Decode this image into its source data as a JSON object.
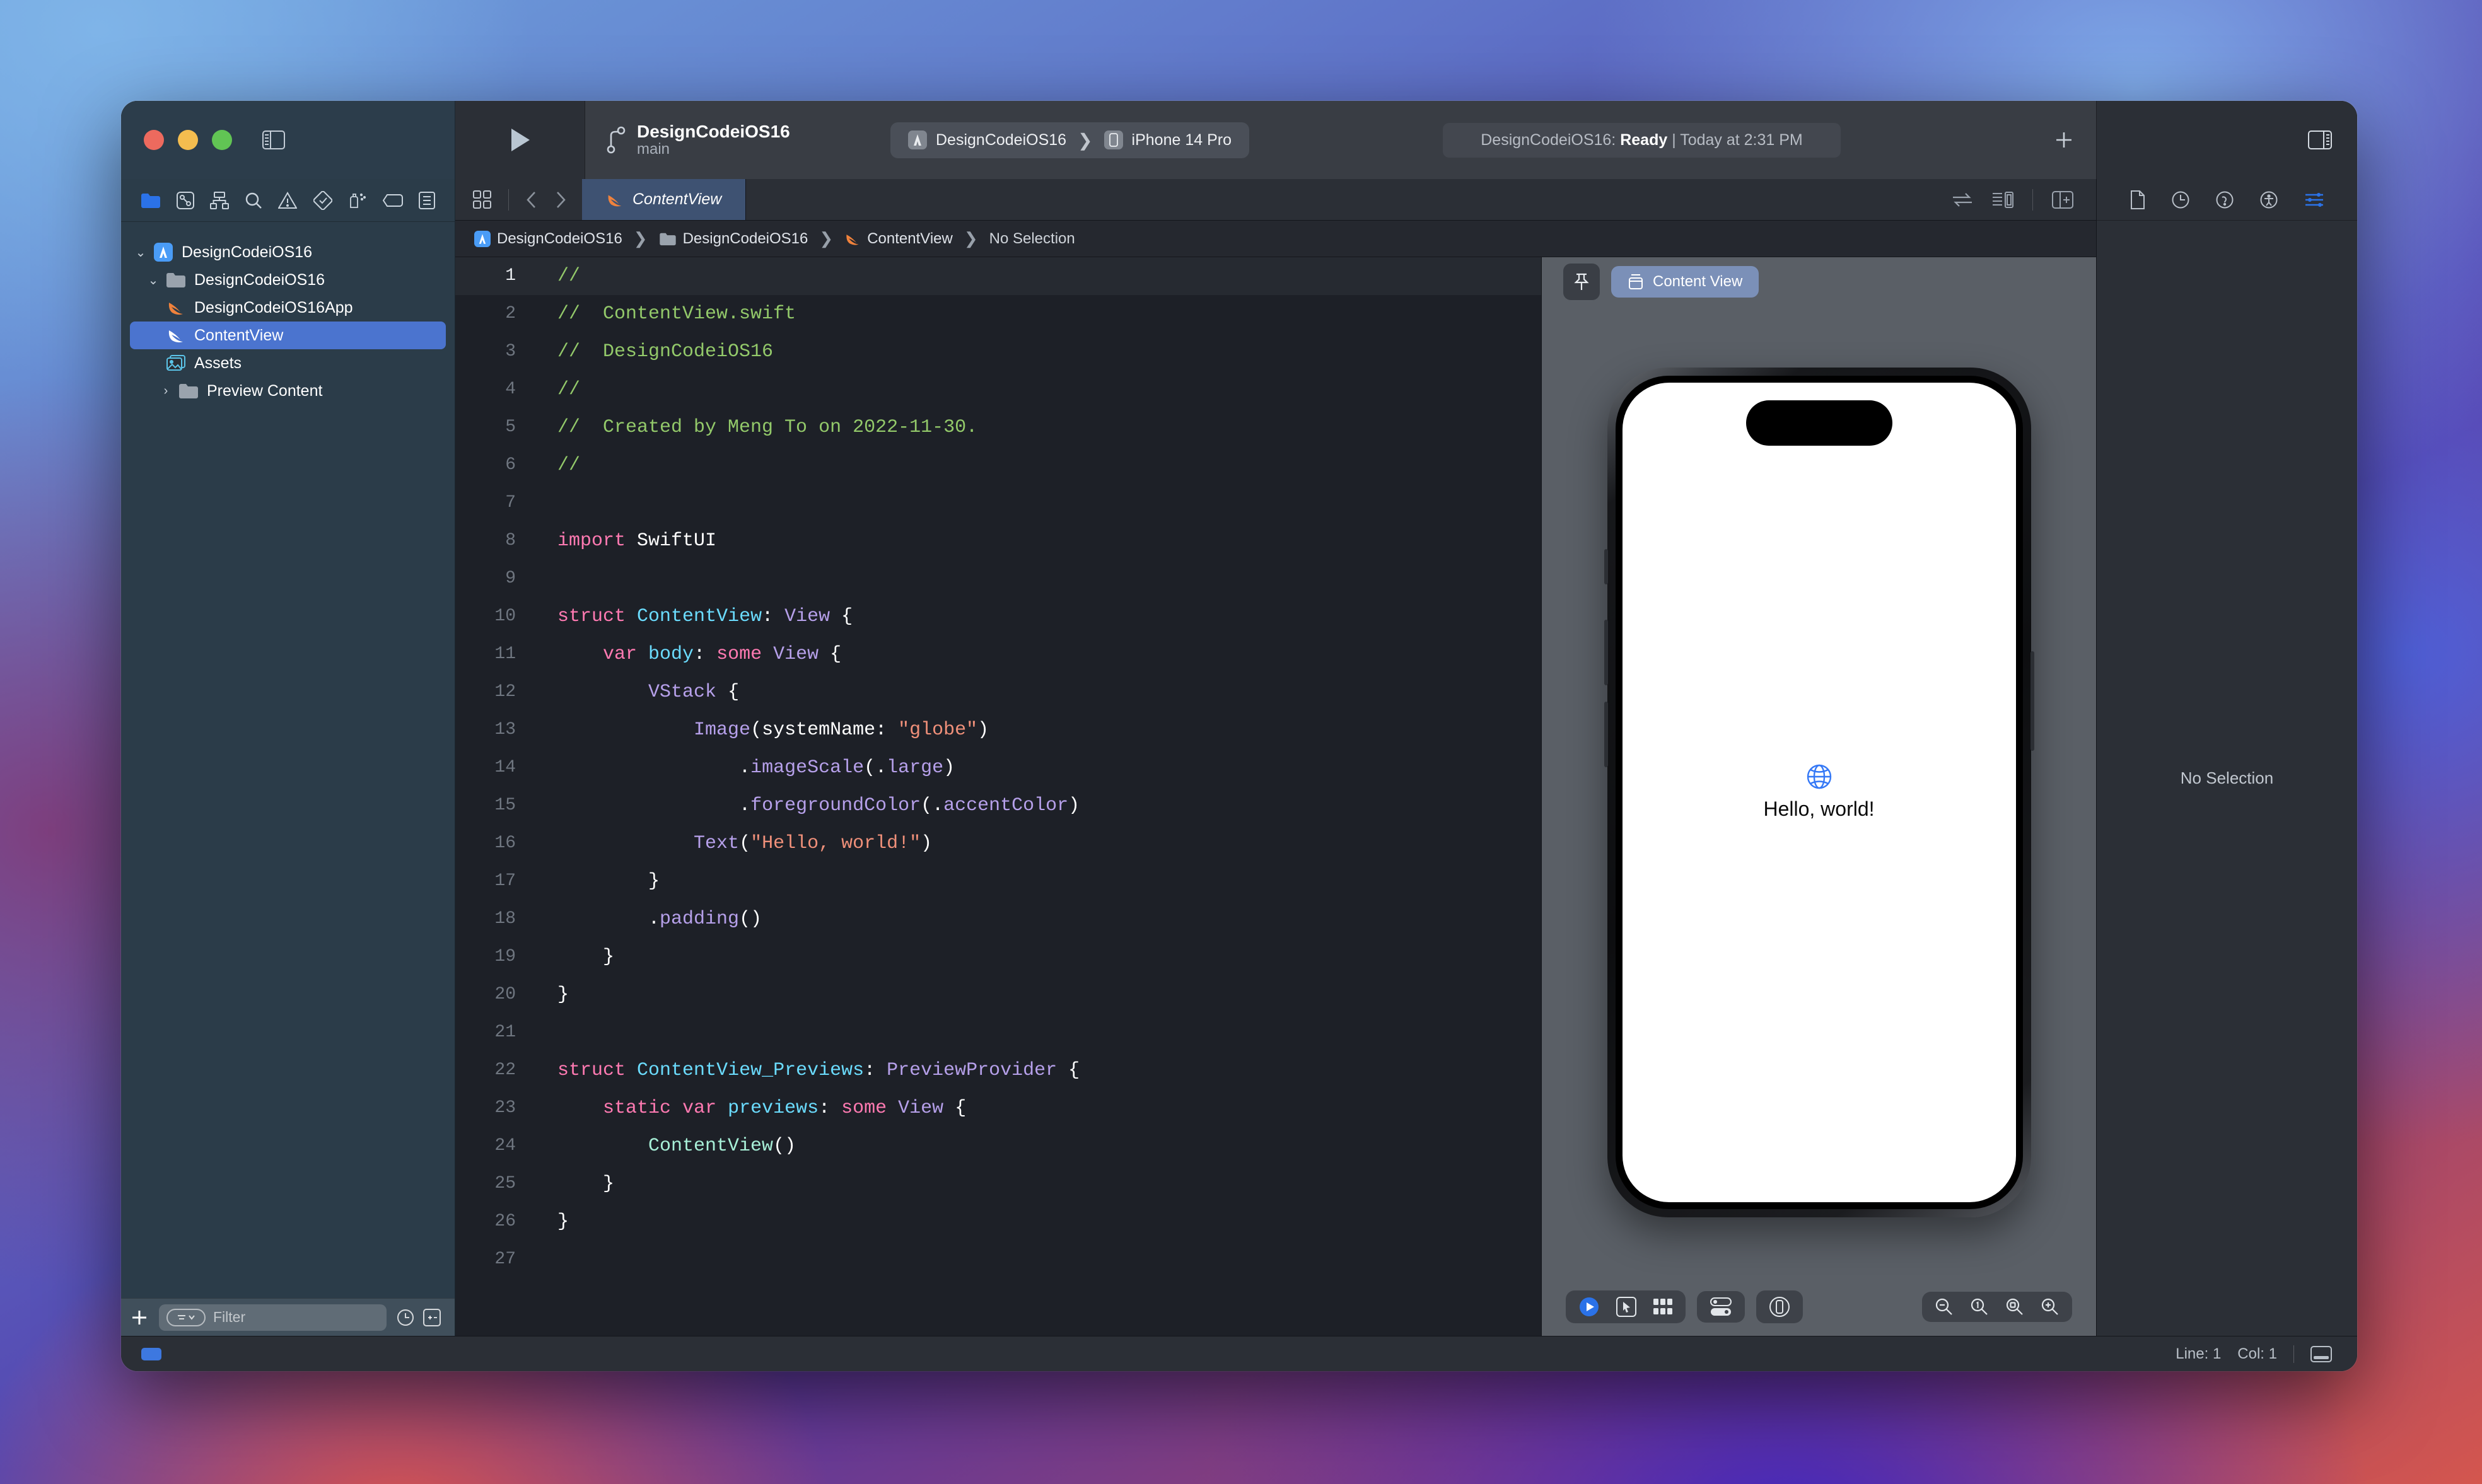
{
  "window": {
    "traffic_lights": [
      "close",
      "minimize",
      "zoom"
    ]
  },
  "toolbar": {
    "project_name": "DesignCodeiOS16",
    "branch": "main",
    "scheme_target": "DesignCodeiOS16",
    "scheme_device": "iPhone 14 Pro",
    "scheme_separator": "❯",
    "status_prefix": "DesignCodeiOS16: ",
    "status_state": "Ready",
    "status_divider": " | ",
    "status_time": "Today at 2:31 PM",
    "run_button": "run-button",
    "add_button": "+"
  },
  "navigator": {
    "tabs": [
      "folder-icon",
      "source-control-icon",
      "symbol-icon",
      "find-icon",
      "issue-icon",
      "test-icon",
      "debug-icon",
      "breakpoint-icon",
      "report-icon"
    ],
    "tree": [
      {
        "label": "DesignCodeiOS16",
        "icon": "xcode-project-icon",
        "indent": 0,
        "twist": "⌄",
        "selected": false
      },
      {
        "label": "DesignCodeiOS16",
        "icon": "folder-icon",
        "indent": 1,
        "twist": "⌄",
        "selected": false
      },
      {
        "label": "DesignCodeiOS16App",
        "icon": "swift-icon",
        "indent": 2,
        "twist": "",
        "selected": false
      },
      {
        "label": "ContentView",
        "icon": "swift-icon",
        "indent": 2,
        "twist": "",
        "selected": true
      },
      {
        "label": "Assets",
        "icon": "assets-icon",
        "indent": 2,
        "twist": "",
        "selected": false
      },
      {
        "label": "Preview Content",
        "icon": "folder-icon",
        "indent": 1,
        "twist": "›",
        "selected": false
      }
    ],
    "filter_placeholder": "Filter",
    "add_label": "+"
  },
  "editor": {
    "tab_label": "ContentView",
    "breadcrumb": [
      {
        "label": "DesignCodeiOS16",
        "icon": "xcode-project-icon"
      },
      {
        "label": "DesignCodeiOS16",
        "icon": "folder-icon"
      },
      {
        "label": "ContentView",
        "icon": "swift-icon"
      },
      {
        "label": "No Selection",
        "icon": ""
      }
    ],
    "breadcrumb_separator": "❯",
    "code": [
      {
        "n": "1",
        "active": true,
        "tokens": [
          {
            "t": "//",
            "c": "cm"
          }
        ]
      },
      {
        "n": "2",
        "active": false,
        "tokens": [
          {
            "t": "//  ContentView.swift",
            "c": "cm"
          }
        ]
      },
      {
        "n": "3",
        "active": false,
        "tokens": [
          {
            "t": "//  DesignCodeiOS16",
            "c": "cm"
          }
        ]
      },
      {
        "n": "4",
        "active": false,
        "tokens": [
          {
            "t": "//",
            "c": "cm"
          }
        ]
      },
      {
        "n": "5",
        "active": false,
        "tokens": [
          {
            "t": "//  Created by Meng To on 2022‑11‑30.",
            "c": "cm"
          }
        ]
      },
      {
        "n": "6",
        "active": false,
        "tokens": [
          {
            "t": "//",
            "c": "cm"
          }
        ]
      },
      {
        "n": "7",
        "active": false,
        "tokens": []
      },
      {
        "n": "8",
        "active": false,
        "tokens": [
          {
            "t": "import",
            "c": "k"
          },
          {
            "t": " SwiftUI",
            "c": "pl"
          }
        ]
      },
      {
        "n": "9",
        "active": false,
        "tokens": []
      },
      {
        "n": "10",
        "active": false,
        "tokens": [
          {
            "t": "struct",
            "c": "k"
          },
          {
            "t": " ",
            "c": "pl"
          },
          {
            "t": "ContentView",
            "c": "ty"
          },
          {
            "t": ": ",
            "c": "pl"
          },
          {
            "t": "View",
            "c": "pu"
          },
          {
            "t": " {",
            "c": "pl"
          }
        ]
      },
      {
        "n": "11",
        "active": false,
        "tokens": [
          {
            "t": "    ",
            "c": "pl"
          },
          {
            "t": "var",
            "c": "k"
          },
          {
            "t": " ",
            "c": "pl"
          },
          {
            "t": "body",
            "c": "ty"
          },
          {
            "t": ": ",
            "c": "pl"
          },
          {
            "t": "some",
            "c": "k"
          },
          {
            "t": " ",
            "c": "pl"
          },
          {
            "t": "View",
            "c": "pu"
          },
          {
            "t": " {",
            "c": "pl"
          }
        ]
      },
      {
        "n": "12",
        "active": false,
        "tokens": [
          {
            "t": "        ",
            "c": "pl"
          },
          {
            "t": "VStack",
            "c": "pu"
          },
          {
            "t": " {",
            "c": "pl"
          }
        ]
      },
      {
        "n": "13",
        "active": false,
        "tokens": [
          {
            "t": "            ",
            "c": "pl"
          },
          {
            "t": "Image",
            "c": "pu"
          },
          {
            "t": "(systemName: ",
            "c": "pl"
          },
          {
            "t": "\"globe\"",
            "c": "st"
          },
          {
            "t": ")",
            "c": "pl"
          }
        ]
      },
      {
        "n": "14",
        "active": false,
        "tokens": [
          {
            "t": "                .",
            "c": "pl"
          },
          {
            "t": "imageScale",
            "c": "pu"
          },
          {
            "t": "(.",
            "c": "pl"
          },
          {
            "t": "large",
            "c": "pu"
          },
          {
            "t": ")",
            "c": "pl"
          }
        ]
      },
      {
        "n": "15",
        "active": false,
        "tokens": [
          {
            "t": "                .",
            "c": "pl"
          },
          {
            "t": "foregroundColor",
            "c": "pu"
          },
          {
            "t": "(.",
            "c": "pl"
          },
          {
            "t": "accentColor",
            "c": "pu"
          },
          {
            "t": ")",
            "c": "pl"
          }
        ]
      },
      {
        "n": "16",
        "active": false,
        "tokens": [
          {
            "t": "            ",
            "c": "pl"
          },
          {
            "t": "Text",
            "c": "pu"
          },
          {
            "t": "(",
            "c": "pl"
          },
          {
            "t": "\"Hello, world!\"",
            "c": "st"
          },
          {
            "t": ")",
            "c": "pl"
          }
        ]
      },
      {
        "n": "17",
        "active": false,
        "tokens": [
          {
            "t": "        }",
            "c": "pl"
          }
        ]
      },
      {
        "n": "18",
        "active": false,
        "tokens": [
          {
            "t": "        .",
            "c": "pl"
          },
          {
            "t": "padding",
            "c": "pu"
          },
          {
            "t": "()",
            "c": "pl"
          }
        ]
      },
      {
        "n": "19",
        "active": false,
        "tokens": [
          {
            "t": "    }",
            "c": "pl"
          }
        ]
      },
      {
        "n": "20",
        "active": false,
        "tokens": [
          {
            "t": "}",
            "c": "pl"
          }
        ]
      },
      {
        "n": "21",
        "active": false,
        "tokens": []
      },
      {
        "n": "22",
        "active": false,
        "tokens": [
          {
            "t": "struct",
            "c": "k"
          },
          {
            "t": " ",
            "c": "pl"
          },
          {
            "t": "ContentView_Previews",
            "c": "ty"
          },
          {
            "t": ": ",
            "c": "pl"
          },
          {
            "t": "PreviewProvider",
            "c": "pu"
          },
          {
            "t": " {",
            "c": "pl"
          }
        ]
      },
      {
        "n": "23",
        "active": false,
        "tokens": [
          {
            "t": "    ",
            "c": "pl"
          },
          {
            "t": "static",
            "c": "k"
          },
          {
            "t": " ",
            "c": "pl"
          },
          {
            "t": "var",
            "c": "k"
          },
          {
            "t": " ",
            "c": "pl"
          },
          {
            "t": "previews",
            "c": "ty"
          },
          {
            "t": ": ",
            "c": "pl"
          },
          {
            "t": "some",
            "c": "k"
          },
          {
            "t": " ",
            "c": "pl"
          },
          {
            "t": "View",
            "c": "pu"
          },
          {
            "t": " {",
            "c": "pl"
          }
        ]
      },
      {
        "n": "24",
        "active": false,
        "tokens": [
          {
            "t": "        ",
            "c": "pl"
          },
          {
            "t": "ContentView",
            "c": "mn"
          },
          {
            "t": "()",
            "c": "pl"
          }
        ]
      },
      {
        "n": "25",
        "active": false,
        "tokens": [
          {
            "t": "    }",
            "c": "pl"
          }
        ]
      },
      {
        "n": "26",
        "active": false,
        "tokens": [
          {
            "t": "}",
            "c": "pl"
          }
        ]
      },
      {
        "n": "27",
        "active": false,
        "tokens": []
      }
    ]
  },
  "canvas": {
    "pin_icon": "pin-icon",
    "preview_label": "Content View",
    "preview_icon": "preview-card-icon",
    "device": "iPhone 14 Pro",
    "screen_text": "Hello, world!",
    "screen_icon": "globe-icon",
    "controls_left": [
      "live-preview-icon",
      "selectable-icon",
      "variants-icon"
    ],
    "controls_mid": [
      "device-settings-icon"
    ],
    "controls_right_group": [
      "device-bezel-icon"
    ],
    "zoom_controls": [
      "zoom-out-icon",
      "zoom-100-icon",
      "zoom-fit-icon",
      "zoom-in-icon"
    ]
  },
  "inspector": {
    "tabs": [
      "file-inspector-icon",
      "history-inspector-icon",
      "quick-help-icon",
      "accessibility-icon",
      "attributes-inspector-icon"
    ],
    "empty_text": "No Selection"
  },
  "statusbar": {
    "line_label": "Line: 1",
    "col_label": "Col: 1"
  },
  "colors": {
    "accent": "#3d78e0",
    "selection": "#4b74cf",
    "swift_orange": "#f0823c",
    "comment_green": "#93c96a",
    "keyword_pink": "#ff7ab2",
    "type_cyan": "#6bdcfe",
    "system_purple": "#b6a0ea",
    "string_salmon": "#f0907a"
  }
}
